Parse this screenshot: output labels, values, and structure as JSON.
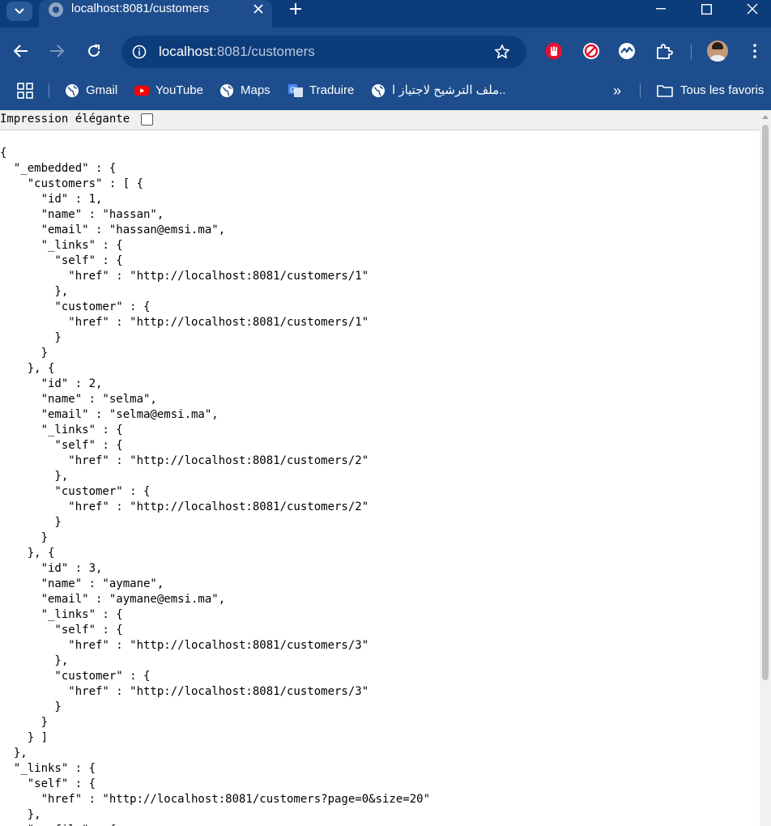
{
  "tab": {
    "title": "localhost:8081/customers",
    "close_icon": "close-icon",
    "new_tab_symbol": "+"
  },
  "toolbar": {
    "url_host": "localhost",
    "url_rest": ":8081/customers"
  },
  "bookmarks": [
    {
      "label": "Gmail",
      "icon": "globe-icon"
    },
    {
      "label": "YouTube",
      "icon": "youtube-icon"
    },
    {
      "label": "Maps",
      "icon": "globe-icon"
    },
    {
      "label": "Traduire",
      "icon": "translate-icon"
    },
    {
      "label": "ملف الترشيح لاجتياز ا...",
      "icon": "globe-icon"
    }
  ],
  "bookmarks_more": "»",
  "all_bookmarks": "Tous les favoris",
  "page": {
    "pretty_print_label": "Impression élégante",
    "json_text": "{\n  \"_embedded\" : {\n    \"customers\" : [ {\n      \"id\" : 1,\n      \"name\" : \"hassan\",\n      \"email\" : \"hassan@emsi.ma\",\n      \"_links\" : {\n        \"self\" : {\n          \"href\" : \"http://localhost:8081/customers/1\"\n        },\n        \"customer\" : {\n          \"href\" : \"http://localhost:8081/customers/1\"\n        }\n      }\n    }, {\n      \"id\" : 2,\n      \"name\" : \"selma\",\n      \"email\" : \"selma@emsi.ma\",\n      \"_links\" : {\n        \"self\" : {\n          \"href\" : \"http://localhost:8081/customers/2\"\n        },\n        \"customer\" : {\n          \"href\" : \"http://localhost:8081/customers/2\"\n        }\n      }\n    }, {\n      \"id\" : 3,\n      \"name\" : \"aymane\",\n      \"email\" : \"aymane@emsi.ma\",\n      \"_links\" : {\n        \"self\" : {\n          \"href\" : \"http://localhost:8081/customers/3\"\n        },\n        \"customer\" : {\n          \"href\" : \"http://localhost:8081/customers/3\"\n        }\n      }\n    } ]\n  },\n  \"_links\" : {\n    \"self\" : {\n      \"href\" : \"http://localhost:8081/customers?page=0&size=20\"\n    },\n    \"profile\" : {"
  },
  "colors": {
    "frame_dark": "#0d3c7a",
    "frame": "#1d4d8c",
    "url_dim": "#b9c8de",
    "ext_red": "#e8112d"
  }
}
